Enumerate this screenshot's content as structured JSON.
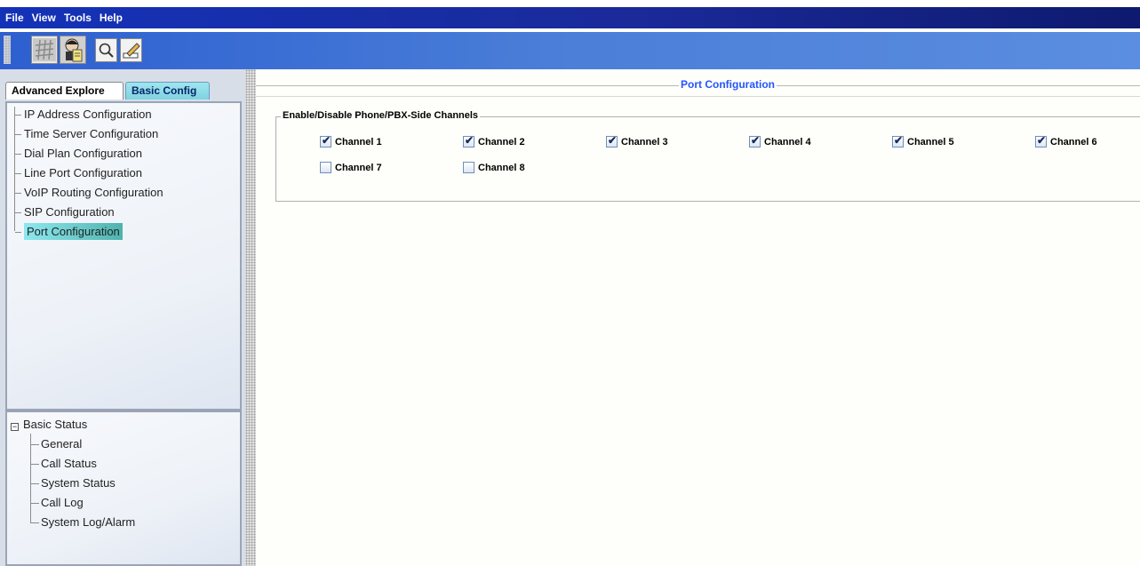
{
  "menu": [
    "File",
    "View",
    "Tools",
    "Help"
  ],
  "toolbar": {
    "buttons": [
      "grid-icon",
      "user-doc-icon",
      "magnifier-icon",
      "pen-icon"
    ]
  },
  "tabs": {
    "advanced": "Advanced Explore",
    "basic": "Basic Config",
    "active": "Basic Config"
  },
  "config_tree": {
    "items": [
      "IP Address Configuration",
      "Time Server Configuration",
      "Dial Plan Configuration",
      "Line Port Configuration",
      "VoIP Routing Configuration",
      "SIP Configuration",
      "Port Configuration"
    ],
    "selected": "Port Configuration"
  },
  "status_tree": {
    "root": "Basic Status",
    "root_expander": "−",
    "items": [
      "General",
      "Call Status",
      "System Status",
      "Call Log",
      "System Log/Alarm"
    ]
  },
  "main": {
    "title": "Port Configuration",
    "group_title": "Enable/Disable Phone/PBX-Side Channels",
    "channels": [
      {
        "label": "Channel 1",
        "checked": true
      },
      {
        "label": "Channel 2",
        "checked": true
      },
      {
        "label": "Channel 3",
        "checked": true
      },
      {
        "label": "Channel 4",
        "checked": true
      },
      {
        "label": "Channel 5",
        "checked": true
      },
      {
        "label": "Channel 6",
        "checked": true
      },
      {
        "label": "Channel 7",
        "checked": false
      },
      {
        "label": "Channel 8",
        "checked": false
      }
    ]
  },
  "colors": {
    "menubar": "#1a2a9a",
    "toolbar": "#4b7fd8",
    "title_text": "#2255ff",
    "selected_item": "#4fb3ad"
  }
}
